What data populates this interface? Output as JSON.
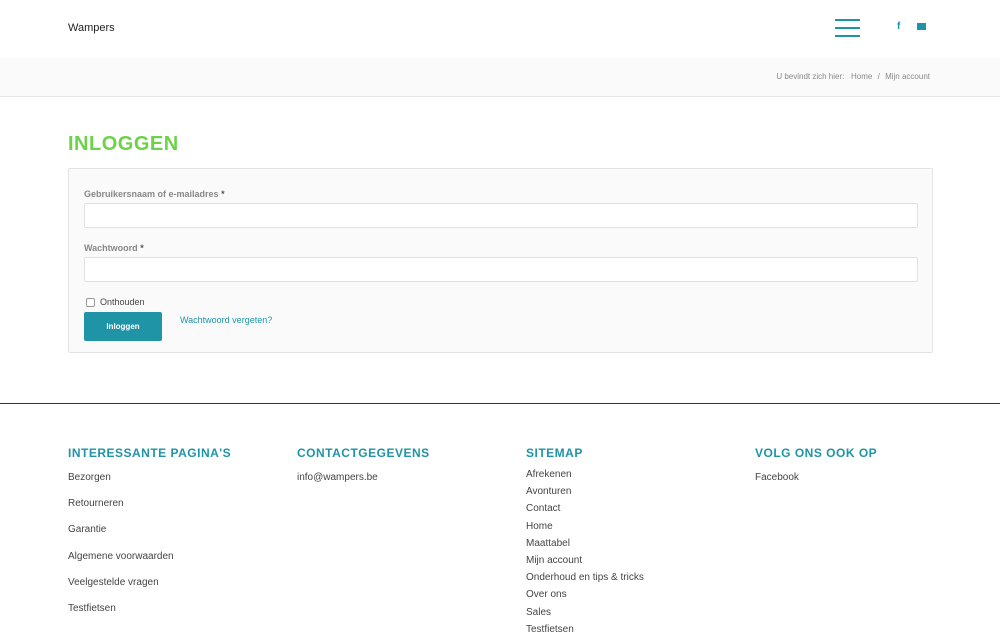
{
  "header": {
    "brand": "Wampers",
    "social": {
      "facebook_glyph": "f"
    }
  },
  "breadcrumb": {
    "prefix": "U bevindt zich hier:",
    "items": [
      "Home",
      "Mijn account"
    ],
    "separator": "/"
  },
  "page_title": "INLOGGEN",
  "login_form": {
    "username_label": "Gebruikersnaam of e-mailadres",
    "password_label": "Wachtwoord",
    "required_mark": "*",
    "username_value": "",
    "password_value": "",
    "remember_label": "Onthouden",
    "remember_checked": false,
    "login_button": "Inloggen",
    "forgot_link": "Wachtwoord vergeten?"
  },
  "footer": {
    "col1": {
      "title": "INTERESSANTE PAGINA'S",
      "links": [
        "Bezorgen",
        "Retourneren",
        "Garantie",
        "Algemene voorwaarden",
        "Veelgestelde vragen",
        "Testfietsen"
      ]
    },
    "col2": {
      "title": "CONTACTGEGEVENS",
      "links": [
        "info@wampers.be"
      ]
    },
    "col3": {
      "title": "SITEMAP",
      "links": [
        "Afrekenen",
        "Avonturen",
        "Contact",
        "Home",
        "Maattabel",
        "Mijn account",
        "Onderhoud en tips & tricks",
        "Over ons",
        "Sales",
        "Testfietsen"
      ]
    },
    "col4": {
      "title": "VOLG ONS OOK OP",
      "links": [
        "Facebook"
      ]
    }
  },
  "colors": {
    "accent": "#1f94a7",
    "title_green": "#6dd24a"
  }
}
